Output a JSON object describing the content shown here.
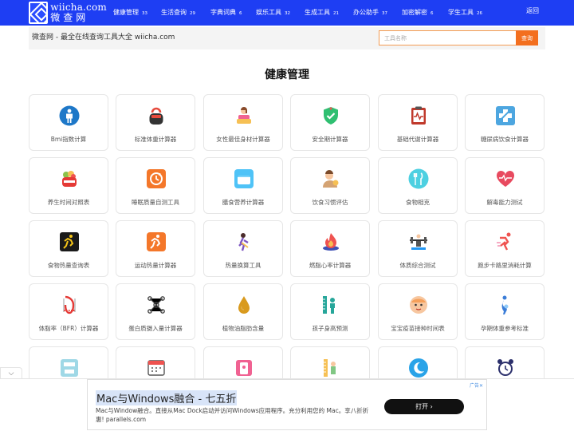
{
  "header": {
    "logo_en": "wiicha.com",
    "logo_cn": "微查网",
    "nav": [
      {
        "label": "健康管理",
        "count": "33"
      },
      {
        "label": "生活查询",
        "count": "29"
      },
      {
        "label": "字典词典",
        "count": "6"
      },
      {
        "label": "娱乐工具",
        "count": "32"
      },
      {
        "label": "生成工具",
        "count": "21"
      },
      {
        "label": "办公助手",
        "count": "37"
      },
      {
        "label": "加密解密",
        "count": "6"
      },
      {
        "label": "学生工具",
        "count": "26"
      }
    ],
    "back": "返回"
  },
  "subbar": {
    "title": "微查网 - 最全在线查询工具大全 wiicha.com",
    "search_placeholder": "工具名称",
    "search_button": "查询"
  },
  "main": {
    "title": "健康管理",
    "tools": [
      {
        "label": "Bmi指数计算",
        "icon": "body-icon"
      },
      {
        "label": "标准体重计算器",
        "icon": "kettlebell-icon"
      },
      {
        "label": "女性最佳身材计算器",
        "icon": "woman-icon"
      },
      {
        "label": "安全期计算器",
        "icon": "shield-check-icon"
      },
      {
        "label": "基础代谢计算器",
        "icon": "heartbeat-clipboard-icon"
      },
      {
        "label": "糖尿病饮食计算器",
        "icon": "medical-cross-icon"
      },
      {
        "label": "养生时间对照表",
        "icon": "salad-icon"
      },
      {
        "label": "睡眠质量自测工具",
        "icon": "sleep-clock-icon"
      },
      {
        "label": "膳食营养计算器",
        "icon": "food-box-icon"
      },
      {
        "label": "饮食习惯评估",
        "icon": "chef-icon"
      },
      {
        "label": "食物相克",
        "icon": "cutlery-icon"
      },
      {
        "label": "解毒能力测试",
        "icon": "heart-pulse-icon"
      },
      {
        "label": "食物热量查询表",
        "icon": "runner-black-icon"
      },
      {
        "label": "运动热量计算器",
        "icon": "runner-orange-icon"
      },
      {
        "label": "热量换算工具",
        "icon": "jogger-icon"
      },
      {
        "label": "燃脂心率计算器",
        "icon": "flame-icon"
      },
      {
        "label": "体质综合测试",
        "icon": "weightlifter-icon"
      },
      {
        "label": "跑步卡路里消耗计算",
        "icon": "sprinter-icon"
      },
      {
        "label": "体脂率（BFR）计算器",
        "icon": "tape-measure-icon"
      },
      {
        "label": "蛋白质摄入量计算器",
        "icon": "molecule-icon"
      },
      {
        "label": "植物油脂肪含量",
        "icon": "oil-drop-icon"
      },
      {
        "label": "孩子身高预测",
        "icon": "height-ruler-icon"
      },
      {
        "label": "宝宝疫苗接种时间表",
        "icon": "baby-icon"
      },
      {
        "label": "孕期体重参考标准",
        "icon": "pregnancy-icon"
      },
      {
        "label": "",
        "icon": "scale-icon"
      },
      {
        "label": "",
        "icon": "calendar-icon"
      },
      {
        "label": "",
        "icon": "phone-icon"
      },
      {
        "label": "",
        "icon": "height-chart-icon"
      },
      {
        "label": "",
        "icon": "moon-icon"
      },
      {
        "label": "",
        "icon": "alarm-clock-icon"
      }
    ]
  },
  "ad": {
    "badge": "广告✕",
    "title": "Mac与Windows融合 - 七五折",
    "desc": "Mac与Window融合。直接从Mac Dock启动并访问Windows应用程序。充分利用您的 Mac。享八折折惠! parallels.com",
    "button": "打开  ›",
    "collapse": "⌵"
  }
}
